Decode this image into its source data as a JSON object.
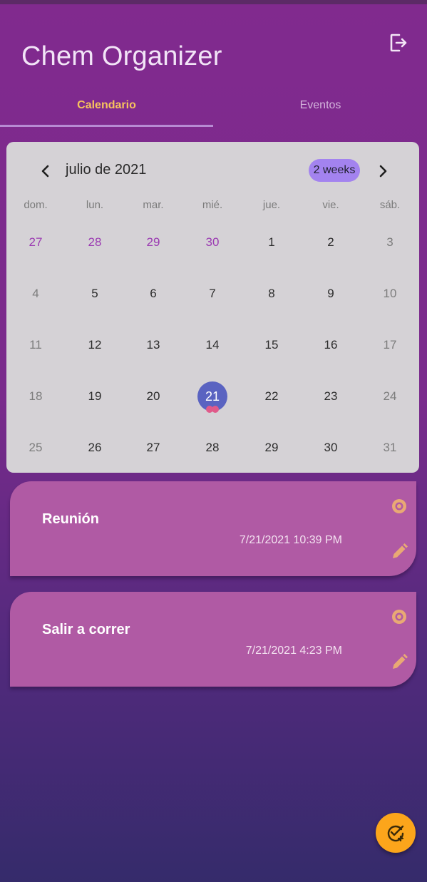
{
  "app": {
    "title": "Chem Organizer"
  },
  "tabs": [
    {
      "label": "Calendario",
      "active": true
    },
    {
      "label": "Eventos",
      "active": false
    }
  ],
  "calendar": {
    "month_label": "julio de 2021",
    "format_button": "2 weeks",
    "weekdays": [
      "dom.",
      "lun.",
      "mar.",
      "mié.",
      "jue.",
      "vie.",
      "sáb."
    ],
    "weeks": [
      [
        "27",
        "28",
        "29",
        "30",
        "1",
        "2",
        "3"
      ],
      [
        "4",
        "5",
        "6",
        "7",
        "8",
        "9",
        "10"
      ],
      [
        "11",
        "12",
        "13",
        "14",
        "15",
        "16",
        "17"
      ],
      [
        "18",
        "19",
        "20",
        "21",
        "22",
        "23",
        "24"
      ],
      [
        "25",
        "26",
        "27",
        "28",
        "29",
        "30",
        "31"
      ]
    ],
    "selected_day": "21",
    "selected_day_event_markers": 2
  },
  "events": [
    {
      "title": "Reunión",
      "datetime": "7/21/2021 10:39 PM"
    },
    {
      "title": "Salir a correr",
      "datetime": "7/21/2021 4:23 PM"
    }
  ],
  "icons": {
    "logout": "logout-icon",
    "prev": "chevron-left-icon",
    "next": "chevron-right-icon",
    "view": "eye-icon",
    "edit": "pencil-icon",
    "fab": "add-task-icon"
  },
  "colors": {
    "header_bg": "#812a8e",
    "tab_active": "#f7c35d",
    "calendar_bg": "#d5d2d6",
    "outside_month_day": "#9b3bb2",
    "selected_day_bg": "#5a63c1",
    "event_marker": "#e05a8a",
    "format_button_bg": "#a383ef",
    "event_card_bg": "#b05aa4",
    "event_icon": "#e9a974",
    "fab_bg": "#fca51b"
  }
}
